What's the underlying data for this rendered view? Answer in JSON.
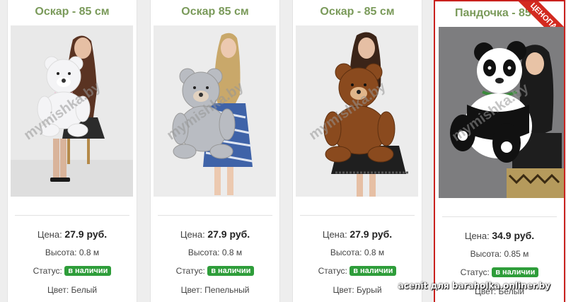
{
  "products": [
    {
      "title": "Оскар - 85 см",
      "price_label": "Цена:",
      "price": "27.9 руб.",
      "height_label": "Высота:",
      "height": "0.8 м",
      "status_label": "Статус:",
      "status": "в наличии",
      "color_label": "Цвет:",
      "color": "Белый",
      "watermark": "mymishka.by",
      "bear_color": "#f4f4f6"
    },
    {
      "title": "Оскар 85 см",
      "price_label": "Цена:",
      "price": "27.9 руб.",
      "height_label": "Высота:",
      "height": "0.8 м",
      "status_label": "Статус:",
      "status": "в наличии",
      "color_label": "Цвет:",
      "color": "Пепельный",
      "watermark": "mymishka.by",
      "bear_color": "#b9bcc2"
    },
    {
      "title": "Оскар - 85 см",
      "price_label": "Цена:",
      "price": "27.9 руб.",
      "height_label": "Высота:",
      "height": "0.8 м",
      "status_label": "Статус:",
      "status": "в наличии",
      "color_label": "Цвет:",
      "color": "Бурый",
      "watermark": "mymishka.by",
      "bear_color": "#8a4a1e"
    },
    {
      "title": "Пандочка - 85",
      "price_label": "Цена:",
      "price": "34.9 руб.",
      "height_label": "Высота:",
      "height": "0.85 м",
      "status_label": "Статус:",
      "status": "в наличии",
      "color_label": "Цвет:",
      "color": "Белый",
      "watermark": "mymishka.by",
      "ribbon": "ЦЕНОПАД",
      "bear_color": "#ffffff"
    }
  ],
  "footer_watermark": "acenit для baraholka.onliner.by",
  "colors": {
    "title": "#7a9a5a",
    "badge": "#2e9d3a",
    "highlight_border": "#c9211e"
  }
}
